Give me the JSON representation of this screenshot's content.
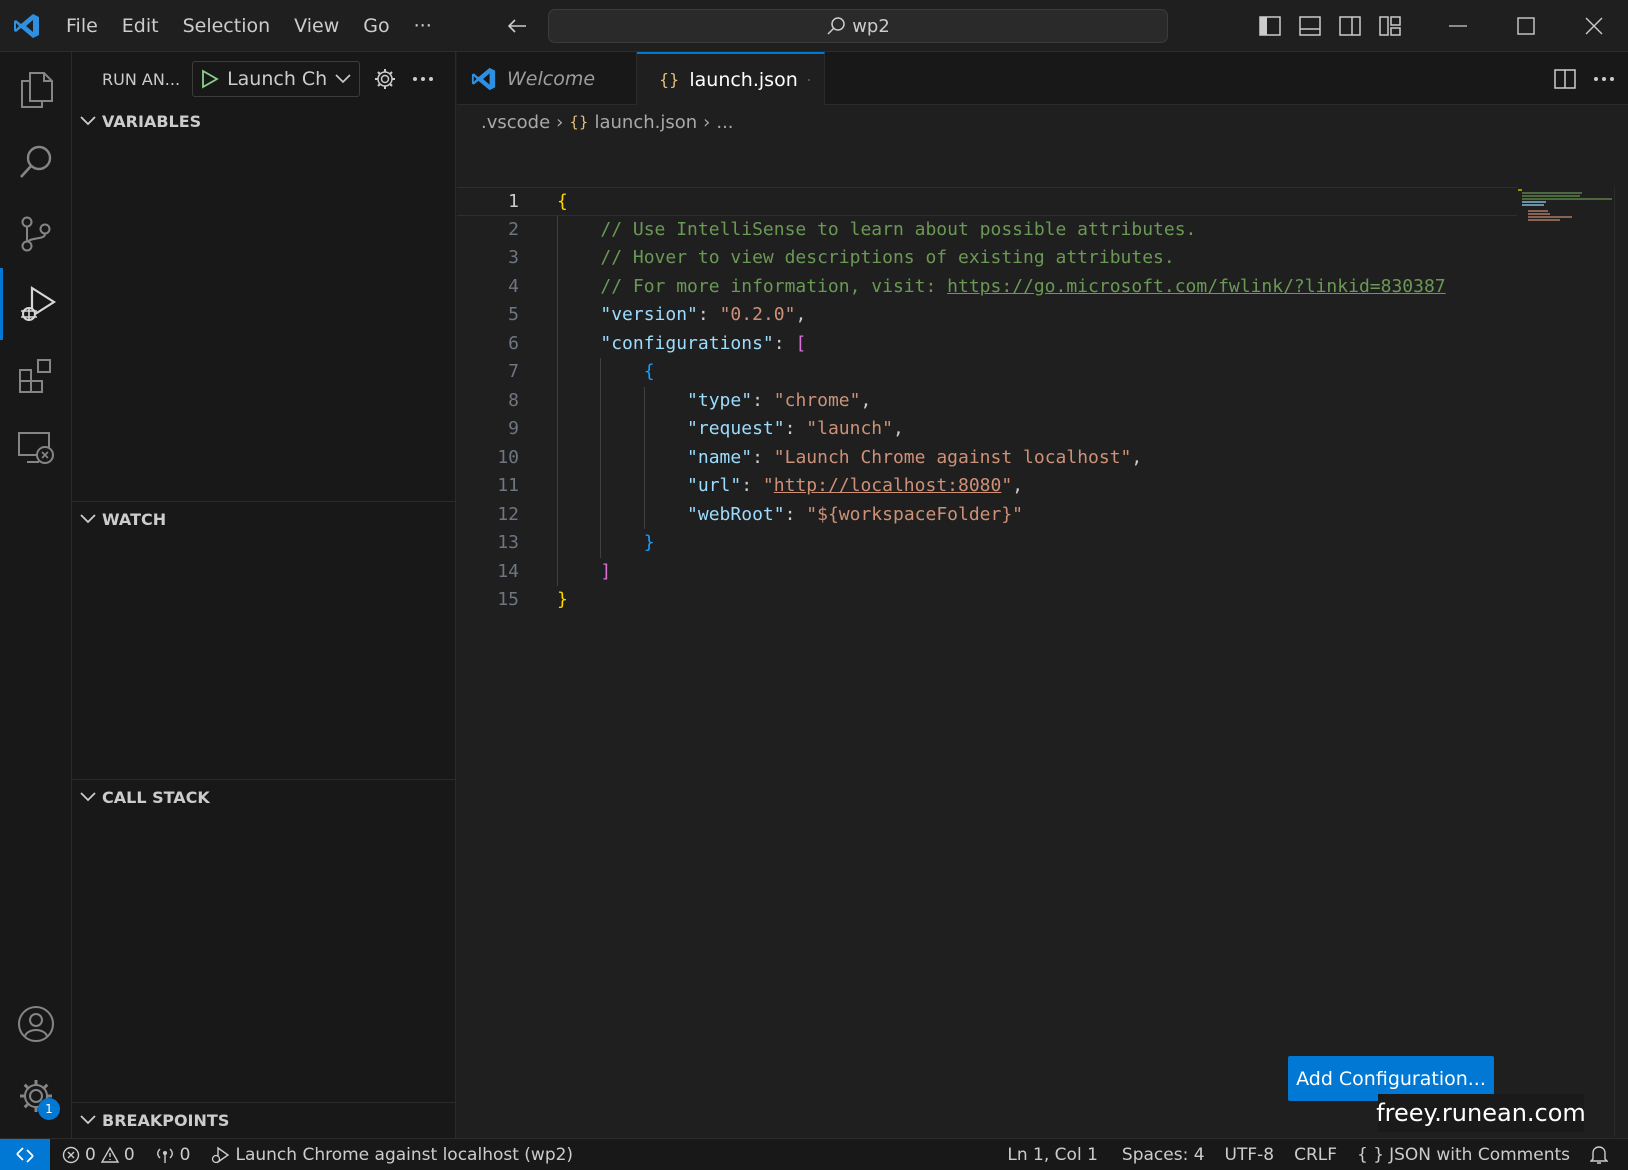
{
  "titlebar": {
    "menu": [
      "File",
      "Edit",
      "Selection",
      "View",
      "Go",
      "···"
    ],
    "search_text": "wp2"
  },
  "activitybar": {
    "items": [
      "explorer-icon",
      "search-icon",
      "source-control-icon",
      "run-debug-icon",
      "extensions-icon",
      "remote-explorer-icon"
    ],
    "bottom": [
      "accounts-icon",
      "manage-gear-icon"
    ],
    "manage_badge": "1"
  },
  "sidebar": {
    "title": "RUN AN...",
    "run_config": "Launch Ch",
    "sections": {
      "variables": "VARIABLES",
      "watch": "WATCH",
      "call_stack": "CALL STACK",
      "breakpoints": "BREAKPOINTS"
    }
  },
  "editor": {
    "tabs": [
      {
        "label": "Welcome",
        "active": false
      },
      {
        "label": "launch.json",
        "active": true
      }
    ],
    "breadcrumb": [
      ".vscode",
      "launch.json",
      "..."
    ],
    "lines": [
      {
        "n": "1",
        "tokens": [
          {
            "t": "{",
            "c": "c-brace"
          }
        ]
      },
      {
        "n": "2",
        "tokens": [
          {
            "t": "    "
          },
          {
            "t": "// Use IntelliSense to learn about possible attributes.",
            "c": "c-comment"
          }
        ]
      },
      {
        "n": "3",
        "tokens": [
          {
            "t": "    "
          },
          {
            "t": "// Hover to view descriptions of existing attributes.",
            "c": "c-comment"
          }
        ]
      },
      {
        "n": "4",
        "tokens": [
          {
            "t": "    "
          },
          {
            "t": "// For more information, visit: ",
            "c": "c-comment"
          },
          {
            "t": "https://go.microsoft.com/fwlink/?linkid=830387",
            "c": "c-comment c-link"
          }
        ]
      },
      {
        "n": "5",
        "tokens": [
          {
            "t": "    "
          },
          {
            "t": "\"version\"",
            "c": "c-key"
          },
          {
            "t": ": ",
            "c": "c-punct"
          },
          {
            "t": "\"0.2.0\"",
            "c": "c-str"
          },
          {
            "t": ",",
            "c": "c-punct"
          }
        ]
      },
      {
        "n": "6",
        "tokens": [
          {
            "t": "    "
          },
          {
            "t": "\"configurations\"",
            "c": "c-key"
          },
          {
            "t": ": ",
            "c": "c-punct"
          },
          {
            "t": "[",
            "c": "c-brack"
          }
        ]
      },
      {
        "n": "7",
        "tokens": [
          {
            "t": "        "
          },
          {
            "t": "{",
            "c": "c-inner"
          }
        ]
      },
      {
        "n": "8",
        "tokens": [
          {
            "t": "            "
          },
          {
            "t": "\"type\"",
            "c": "c-key"
          },
          {
            "t": ": ",
            "c": "c-punct"
          },
          {
            "t": "\"chrome\"",
            "c": "c-str"
          },
          {
            "t": ",",
            "c": "c-punct"
          }
        ]
      },
      {
        "n": "9",
        "tokens": [
          {
            "t": "            "
          },
          {
            "t": "\"request\"",
            "c": "c-key"
          },
          {
            "t": ": ",
            "c": "c-punct"
          },
          {
            "t": "\"launch\"",
            "c": "c-str"
          },
          {
            "t": ",",
            "c": "c-punct"
          }
        ]
      },
      {
        "n": "10",
        "tokens": [
          {
            "t": "            "
          },
          {
            "t": "\"name\"",
            "c": "c-key"
          },
          {
            "t": ": ",
            "c": "c-punct"
          },
          {
            "t": "\"Launch Chrome against localhost\"",
            "c": "c-str"
          },
          {
            "t": ",",
            "c": "c-punct"
          }
        ]
      },
      {
        "n": "11",
        "tokens": [
          {
            "t": "            "
          },
          {
            "t": "\"url\"",
            "c": "c-key"
          },
          {
            "t": ": ",
            "c": "c-punct"
          },
          {
            "t": "\"",
            "c": "c-str"
          },
          {
            "t": "http://localhost:8080",
            "c": "c-str c-link"
          },
          {
            "t": "\"",
            "c": "c-str"
          },
          {
            "t": ",",
            "c": "c-punct"
          }
        ]
      },
      {
        "n": "12",
        "tokens": [
          {
            "t": "            "
          },
          {
            "t": "\"webRoot\"",
            "c": "c-key"
          },
          {
            "t": ": ",
            "c": "c-punct"
          },
          {
            "t": "\"${workspaceFolder}\"",
            "c": "c-str"
          }
        ]
      },
      {
        "n": "13",
        "tokens": [
          {
            "t": "        "
          },
          {
            "t": "}",
            "c": "c-inner"
          }
        ]
      },
      {
        "n": "14",
        "tokens": [
          {
            "t": "    "
          },
          {
            "t": "]",
            "c": "c-brack"
          }
        ]
      },
      {
        "n": "15",
        "tokens": [
          {
            "t": "}",
            "c": "c-brace"
          }
        ]
      }
    ],
    "add_config_button": "Add Configuration...",
    "watermark": "freey.runean.com"
  },
  "statusbar": {
    "errors": "0",
    "warnings": "0",
    "ports": "0",
    "debug_target": "Launch Chrome against localhost (wp2)",
    "position": "Ln 1, Col 1",
    "spaces": "Spaces: 4",
    "encoding": "UTF-8",
    "eol": "CRLF",
    "language_braces": "{ }",
    "language": "JSON with Comments"
  },
  "colors": {
    "accent": "#0078d4",
    "background": "#1f1f1f",
    "sidebar": "#181818"
  }
}
